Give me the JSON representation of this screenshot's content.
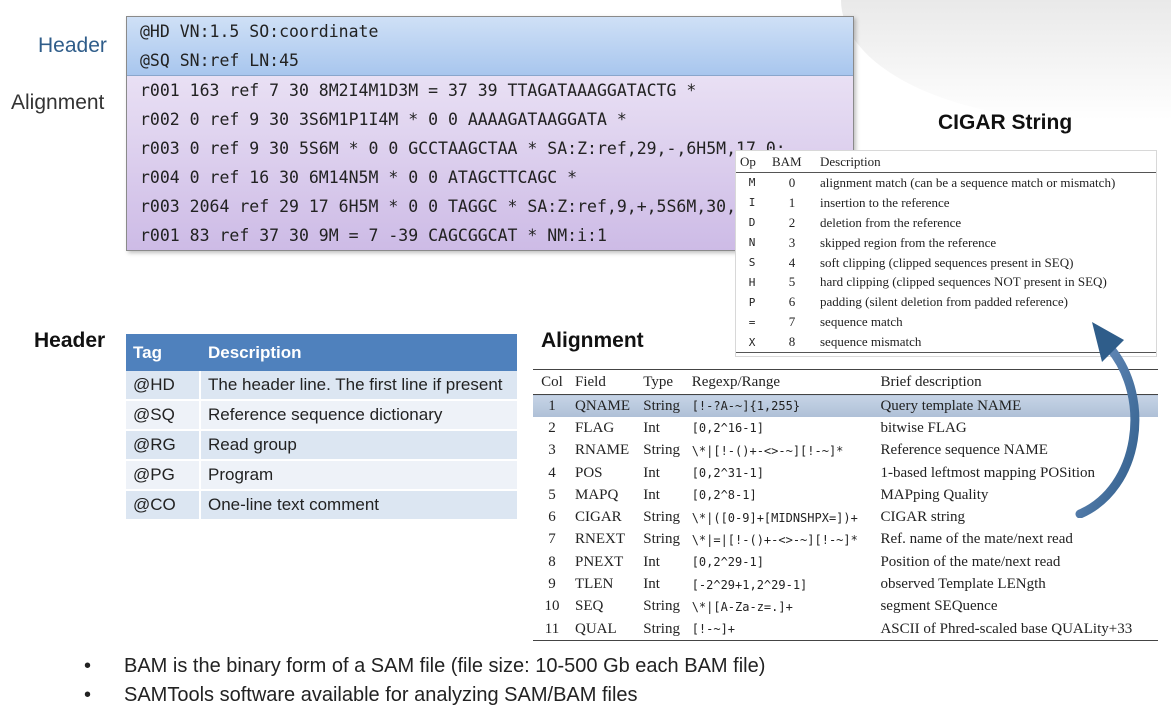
{
  "labels": {
    "header_top": "Header",
    "alignment_top": "Alignment",
    "cigar_title": "CIGAR String",
    "header_section": "Header",
    "alignment_section": "Alignment"
  },
  "sam_example": {
    "header_lines": [
      "@HD VN:1.5 SO:coordinate",
      "@SQ SN:ref LN:45"
    ],
    "alignment_lines": [
      "r001 163 ref 7 30 8M2I4M1D3M = 37 39 TTAGATAAAGGATACTG *",
      "r002 0 ref 9 30 3S6M1P1I4M * 0 0 AAAAGATAAGGATA *",
      "r003 0 ref 9 30 5S6M * 0 0 GCCTAAGCTAA * SA:Z:ref,29,-,6H5M,17,0;",
      "r004 0 ref 16 30 6M14N5M * 0 0 ATAGCTTCAGC *",
      "r003 2064 ref 29 17 6H5M * 0 0 TAGGC * SA:Z:ref,9,+,5S6M,30,1;",
      "r001 83 ref 37 30 9M = 7 -39 CAGCGGCAT * NM:i:1"
    ]
  },
  "cigar_table": {
    "columns": [
      "Op",
      "BAM",
      "Description"
    ],
    "rows": [
      {
        "op": "M",
        "bam": "0",
        "desc": "alignment match (can be a sequence match or mismatch)"
      },
      {
        "op": "I",
        "bam": "1",
        "desc": "insertion to the reference"
      },
      {
        "op": "D",
        "bam": "2",
        "desc": "deletion from the reference"
      },
      {
        "op": "N",
        "bam": "3",
        "desc": "skipped region from the reference"
      },
      {
        "op": "S",
        "bam": "4",
        "desc": "soft clipping (clipped sequences present in SEQ)"
      },
      {
        "op": "H",
        "bam": "5",
        "desc": "hard clipping (clipped sequences NOT present in SEQ)"
      },
      {
        "op": "P",
        "bam": "6",
        "desc": "padding (silent deletion from padded reference)"
      },
      {
        "op": "=",
        "bam": "7",
        "desc": "sequence match"
      },
      {
        "op": "X",
        "bam": "8",
        "desc": "sequence mismatch"
      }
    ]
  },
  "header_table": {
    "columns": [
      "Tag",
      "Description"
    ],
    "rows": [
      {
        "tag": "@HD",
        "desc": "The header line. The first line if present"
      },
      {
        "tag": "@SQ",
        "desc": "Reference sequence dictionary"
      },
      {
        "tag": "@RG",
        "desc": "Read group"
      },
      {
        "tag": "@PG",
        "desc": "Program"
      },
      {
        "tag": "@CO",
        "desc": "One-line text comment"
      }
    ]
  },
  "alignment_table": {
    "columns": [
      "Col",
      "Field",
      "Type",
      "Regexp/Range",
      "Brief description"
    ],
    "rows": [
      {
        "col": "1",
        "field": "QNAME",
        "type": "String",
        "regexp": "[!-?A-~]{1,255}",
        "desc": "Query template NAME",
        "highlight": true
      },
      {
        "col": "2",
        "field": "FLAG",
        "type": "Int",
        "regexp": "[0,2^16-1]",
        "desc": "bitwise FLAG"
      },
      {
        "col": "3",
        "field": "RNAME",
        "type": "String",
        "regexp": "\\*|[!-()+-<>-~][!-~]*",
        "desc": "Reference sequence NAME"
      },
      {
        "col": "4",
        "field": "POS",
        "type": "Int",
        "regexp": "[0,2^31-1]",
        "desc": "1-based leftmost mapping POSition"
      },
      {
        "col": "5",
        "field": "MAPQ",
        "type": "Int",
        "regexp": "[0,2^8-1]",
        "desc": "MAPping Quality"
      },
      {
        "col": "6",
        "field": "CIGAR",
        "type": "String",
        "regexp": "\\*|([0-9]+[MIDNSHPX=])+",
        "desc": "CIGAR string"
      },
      {
        "col": "7",
        "field": "RNEXT",
        "type": "String",
        "regexp": "\\*|=|[!-()+-<>-~][!-~]*",
        "desc": "Ref. name of the mate/next read"
      },
      {
        "col": "8",
        "field": "PNEXT",
        "type": "Int",
        "regexp": "[0,2^29-1]",
        "desc": "Position of the mate/next read"
      },
      {
        "col": "9",
        "field": "TLEN",
        "type": "Int",
        "regexp": "[-2^29+1,2^29-1]",
        "desc": "observed Template LENgth"
      },
      {
        "col": "10",
        "field": "SEQ",
        "type": "String",
        "regexp": "\\*|[A-Za-z=.]+",
        "desc": "segment SEQuence"
      },
      {
        "col": "11",
        "field": "QUAL",
        "type": "String",
        "regexp": "[!-~]+",
        "desc": "ASCII of Phred-scaled base QUALity+33"
      }
    ]
  },
  "bullets": {
    "marker": "•",
    "items": [
      "BAM is the binary form of a SAM file (file size: 10-500 Gb each BAM file)",
      "SAMTools software available for analyzing SAM/BAM files"
    ]
  },
  "colors": {
    "header_label": "#2f5d8a",
    "sam_header_bg": "#b9d1f1",
    "sam_alignment_bg": "#ddd0ee",
    "table_header": "#4f81bd",
    "table_row": "#dce6f2",
    "arrow": "#2f5d8a"
  }
}
